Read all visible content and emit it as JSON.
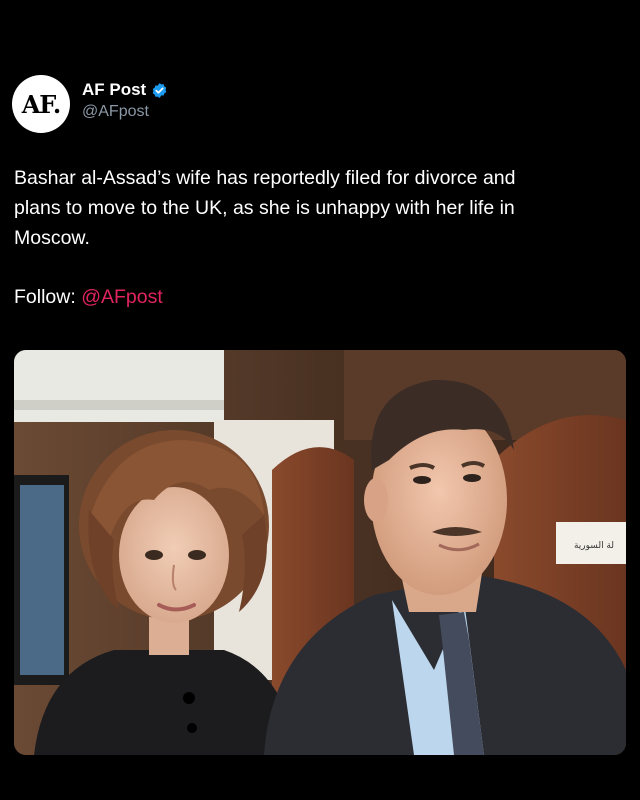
{
  "account": {
    "avatar_text": "AF.",
    "display_name": "AF Post",
    "handle": "@AFpost",
    "verified_icon": "verified-badge-icon",
    "verified_color": "#1d9bf0"
  },
  "post": {
    "text": "Bashar al-Assad’s wife has reportedly filed for divorce and\nplans to move to the UK, as she is unhappy with her life in\nMoscow.",
    "follow_label": "Follow:",
    "follow_mention": "@AFpost",
    "mention_color": "#e0245e"
  },
  "media": {
    "kind": "photo",
    "sign_text": "لة السورية"
  },
  "colors": {
    "background": "#000000",
    "text": "#ffffff",
    "secondary": "#8b98a5"
  }
}
